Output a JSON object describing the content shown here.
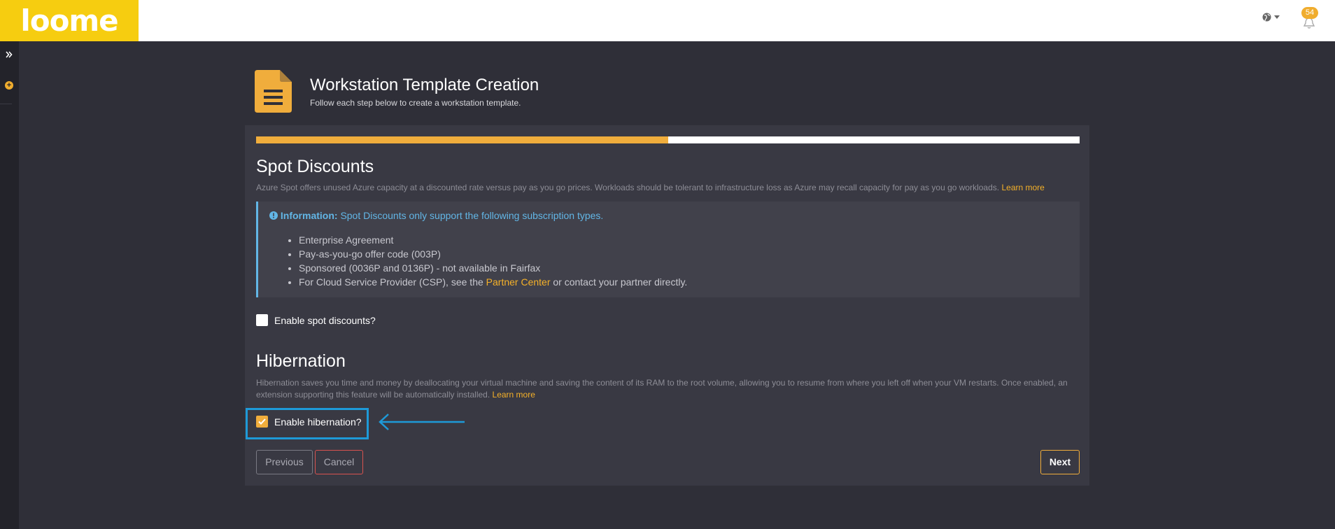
{
  "header": {
    "logo": "loome",
    "notification_count": "54"
  },
  "page": {
    "title": "Workstation Template Creation",
    "subtitle": "Follow each step below to create a workstation template."
  },
  "wizard": {
    "progress_percent": 50
  },
  "spot": {
    "heading": "Spot Discounts",
    "description": "Azure Spot offers unused Azure capacity at a discounted rate versus pay as you go prices. Workloads should be tolerant to infrastructure loss as Azure may recall capacity for pay as you go workloads.",
    "learn_more": "Learn more",
    "info_label": "Information:",
    "info_text": "Spot Discounts only support the following subscription types.",
    "items": [
      "Enterprise Agreement",
      "Pay-as-you-go offer code (003P)",
      "Sponsored (0036P and 0136P) - not available in Fairfax"
    ],
    "csp_prefix": "For Cloud Service Provider (CSP), see the",
    "csp_link": "Partner Center",
    "csp_suffix": "or contact your partner directly.",
    "checkbox_label": "Enable spot discounts?",
    "checked": false
  },
  "hibernation": {
    "heading": "Hibernation",
    "description": "Hibernation saves you time and money by deallocating your virtual machine and saving the content of its RAM to the root volume, allowing you to resume from where you left off when your VM restarts. Once enabled, an extension supporting this feature will be automatically installed.",
    "learn_more": "Learn more",
    "checkbox_label": "Enable hibernation?",
    "checked": true
  },
  "buttons": {
    "previous": "Previous",
    "cancel": "Cancel",
    "next": "Next"
  },
  "colors": {
    "accent": "#f0ad3c",
    "info": "#62b6e6",
    "highlight": "#1e9ad8",
    "logo_bg": "#f6cd10"
  }
}
